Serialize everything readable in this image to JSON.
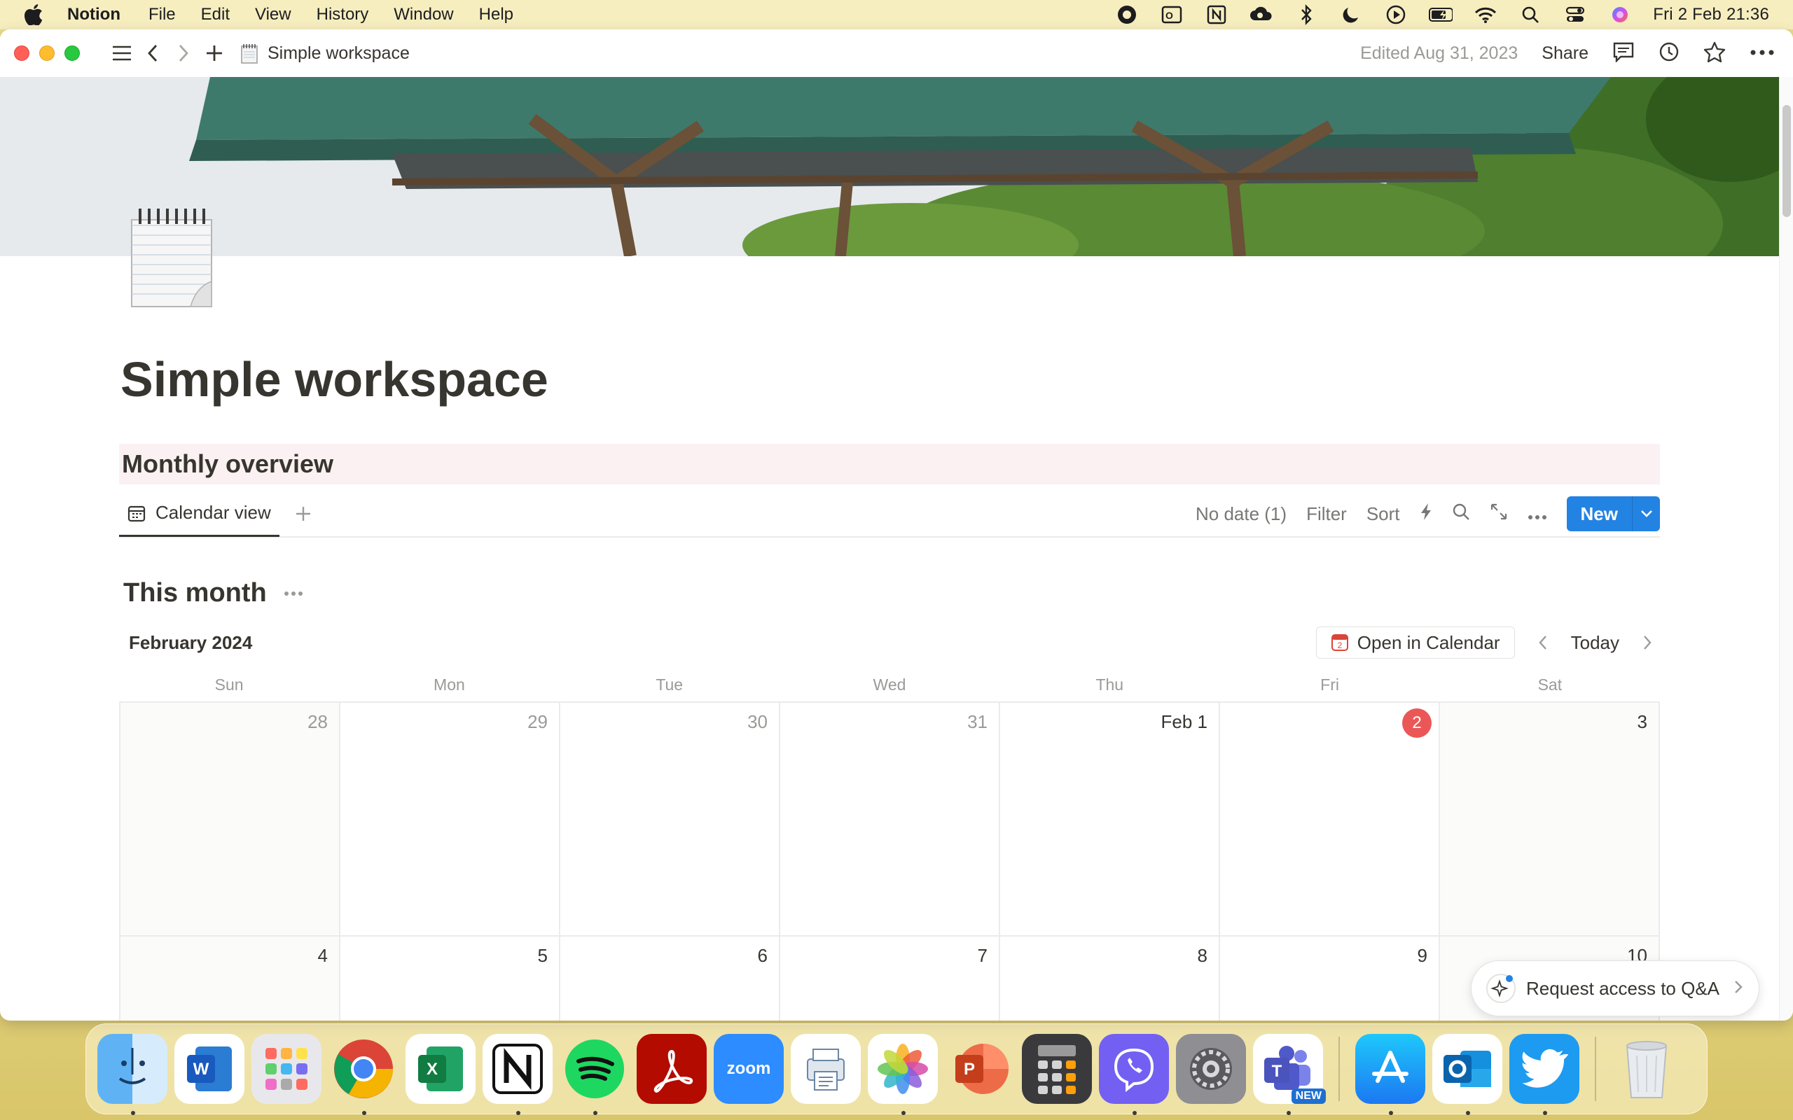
{
  "menubar": {
    "app_name": "Notion",
    "menus": [
      "File",
      "Edit",
      "View",
      "History",
      "Window",
      "Help"
    ],
    "clock": "Fri 2 Feb  21:36"
  },
  "window": {
    "breadcrumb": "Simple workspace",
    "edited": "Edited Aug 31, 2023",
    "share_label": "Share"
  },
  "page": {
    "title": "Simple workspace",
    "callout": "Monthly overview"
  },
  "database": {
    "view_tab": "Calendar view",
    "no_date": "No date (1)",
    "filter_label": "Filter",
    "sort_label": "Sort",
    "new_label": "New"
  },
  "calendar": {
    "heading": "This month",
    "month_label": "February 2024",
    "open_in_calendar": "Open in Calendar",
    "today_label": "Today",
    "open_cal_icon_text": "2",
    "weekdays": [
      "Sun",
      "Mon",
      "Tue",
      "Wed",
      "Thu",
      "Fri",
      "Sat"
    ],
    "days": [
      "28",
      "29",
      "30",
      "31",
      "Feb 1",
      "2",
      "3",
      "4",
      "5",
      "6",
      "7",
      "8",
      "9",
      "10"
    ]
  },
  "qa": {
    "label": "Request access to Q&A"
  },
  "dock": {
    "new_badge": "NEW",
    "zoom_label": "zoom"
  },
  "colors": {
    "accent_blue": "#2383e2",
    "today_red": "#eb5757",
    "text": "#37352f",
    "muted": "#9b9a97"
  }
}
